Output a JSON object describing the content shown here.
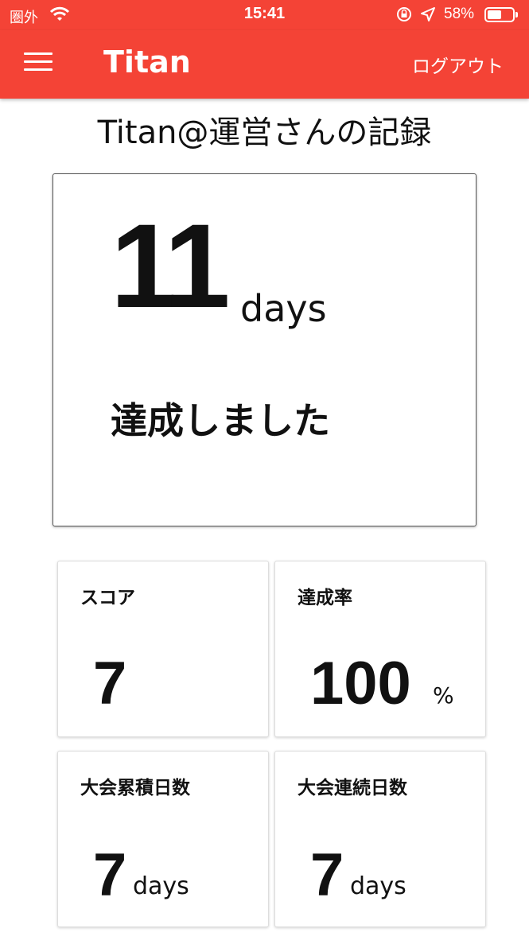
{
  "status_bar": {
    "carrier": "圏外",
    "time": "15:41",
    "battery_percent": "58%",
    "battery_level": 0.58
  },
  "app_bar": {
    "title": "Titan",
    "logout_label": "ログアウト"
  },
  "page": {
    "record_title": "Titan@運営さんの記録"
  },
  "main_card": {
    "days_count": "11",
    "days_unit": "days",
    "achieved_text": "達成しました"
  },
  "stats": {
    "score": {
      "label": "スコア",
      "value": "7"
    },
    "rate": {
      "label": "達成率",
      "value": "100",
      "unit": "%"
    },
    "total_days": {
      "label": "大会累積日数",
      "value": "7",
      "unit": "days"
    },
    "streak_days": {
      "label": "大会連続日数",
      "value": "7",
      "unit": "days"
    }
  },
  "colors": {
    "accent": "#f44336"
  },
  "icons": [
    "wifi-icon",
    "orientation-lock-icon",
    "location-arrow-icon",
    "battery-icon",
    "menu-icon"
  ]
}
